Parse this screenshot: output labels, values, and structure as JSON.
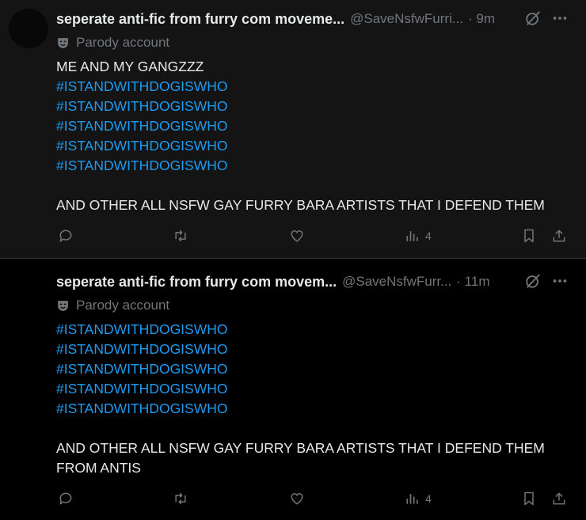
{
  "tweets": [
    {
      "author_name": "seperate anti-fic from furry com moveme...",
      "handle": "@SaveNsfwFurri...",
      "time": "· 9m",
      "parody_label": "Parody account",
      "lines": [
        "ME AND MY GANGZZZ",
        "#ISTANDWITHDOGISWHO",
        "#ISTANDWITHDOGISWHO",
        "#ISTANDWITHDOGISWHO",
        "#ISTANDWITHDOGISWHO",
        "#ISTANDWITHDOGISWHO",
        "",
        "AND OTHER ALL NSFW GAY FURRY BARA ARTISTS THAT I DEFEND THEM"
      ],
      "views": "4"
    },
    {
      "author_name": "seperate anti-fic from furry com movem...",
      "handle": "@SaveNsfwFurr...",
      "time": "· 11m",
      "parody_label": "Parody account",
      "lines": [
        "#ISTANDWITHDOGISWHO",
        "#ISTANDWITHDOGISWHO",
        "#ISTANDWITHDOGISWHO",
        "#ISTANDWITHDOGISWHO",
        "#ISTANDWITHDOGISWHO",
        "",
        "AND OTHER ALL NSFW GAY FURRY BARA ARTISTS THAT I DEFEND THEM",
        "FROM ANTIS"
      ],
      "views": "4"
    }
  ],
  "icons": {
    "grok": "grok-icon",
    "more": "more-icon",
    "parody": "theater-mask-icon",
    "reply": "reply-icon",
    "repost": "repost-icon",
    "like": "like-icon",
    "views": "views-icon",
    "bookmark": "bookmark-icon",
    "share": "share-icon"
  },
  "colors": {
    "background": "#000000",
    "highlighted_background": "#141414",
    "text": "#e7e9ea",
    "secondary_text": "#71767b",
    "hashtag": "#1d9bf0"
  }
}
